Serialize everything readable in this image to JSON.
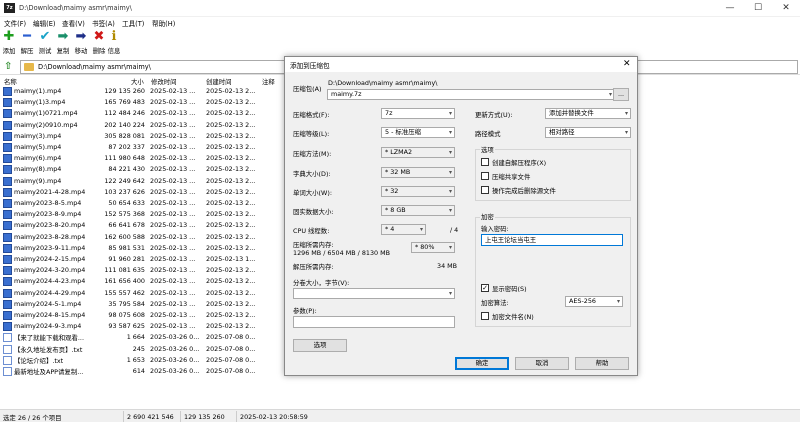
{
  "window": {
    "title": "D:\\Download\\maimy asmr\\maimy\\",
    "app_icon_text": "7z"
  },
  "window_controls": {
    "minimize": "—",
    "maximize": "☐",
    "close": "✕"
  },
  "menu": [
    "文件(F)",
    "编辑(E)",
    "查看(V)",
    "书签(A)",
    "工具(T)",
    "帮助(H)"
  ],
  "toolbar": [
    {
      "label": "添加",
      "icon": "plus-icon",
      "glyph": "✚",
      "color": "#1e9e1e"
    },
    {
      "label": "解压",
      "icon": "minus-icon",
      "glyph": "━",
      "color": "#2b5fd0"
    },
    {
      "label": "测试",
      "icon": "check-icon",
      "glyph": "✔",
      "color": "#1aa3c8"
    },
    {
      "label": "复制",
      "icon": "copy-arrow-icon",
      "glyph": "➡",
      "color": "#1a8f6a"
    },
    {
      "label": "移动",
      "icon": "move-arrow-icon",
      "glyph": "➡",
      "color": "#1e2f88"
    },
    {
      "label": "删除",
      "icon": "delete-x-icon",
      "glyph": "✖",
      "color": "#d01818"
    },
    {
      "label": "信息",
      "icon": "info-icon",
      "glyph": "ℹ",
      "color": "#b08a00"
    }
  ],
  "path": "D:\\Download\\maimy asmr\\maimy\\",
  "columns": {
    "name": "名称",
    "size": "大小",
    "modified": "修改时间",
    "created": "创建时间",
    "comment": "注释"
  },
  "files": [
    {
      "name": "maimy(1).mp4",
      "size": "129 135 260",
      "modified": "2025-02-13 ...",
      "created": "2025-02-13 2...",
      "type": "video"
    },
    {
      "name": "maimy(1)3.mp4",
      "size": "165 769 483",
      "modified": "2025-02-13 ...",
      "created": "2025-02-13 2...",
      "type": "video"
    },
    {
      "name": "maimy(1)0721.mp4",
      "size": "112 484 246",
      "modified": "2025-02-13 ...",
      "created": "2025-02-13 2...",
      "type": "video"
    },
    {
      "name": "maimy(2)0910.mp4",
      "size": "202 140 224",
      "modified": "2025-02-13 ...",
      "created": "2025-02-13 2...",
      "type": "video"
    },
    {
      "name": "maimy(3).mp4",
      "size": "305 828 081",
      "modified": "2025-02-13 ...",
      "created": "2025-02-13 2...",
      "type": "video"
    },
    {
      "name": "maimy(5).mp4",
      "size": "87 202 337",
      "modified": "2025-02-13 ...",
      "created": "2025-02-13 2...",
      "type": "video"
    },
    {
      "name": "maimy(6).mp4",
      "size": "111 980 648",
      "modified": "2025-02-13 ...",
      "created": "2025-02-13 2...",
      "type": "video"
    },
    {
      "name": "maimy(8).mp4",
      "size": "84 221 430",
      "modified": "2025-02-13 ...",
      "created": "2025-02-13 2...",
      "type": "video"
    },
    {
      "name": "maimy(9).mp4",
      "size": "122 249 642",
      "modified": "2025-02-13 ...",
      "created": "2025-02-13 2...",
      "type": "video"
    },
    {
      "name": "maimy2021-4-28.mp4",
      "size": "103 237 626",
      "modified": "2025-02-13 ...",
      "created": "2025-02-13 2...",
      "type": "video"
    },
    {
      "name": "maimy2023-8-5.mp4",
      "size": "50 654 633",
      "modified": "2025-02-13 ...",
      "created": "2025-02-13 2...",
      "type": "video"
    },
    {
      "name": "maimy2023-8-9.mp4",
      "size": "152 575 368",
      "modified": "2025-02-13 ...",
      "created": "2025-02-13 2...",
      "type": "video"
    },
    {
      "name": "maimy2023-8-20.mp4",
      "size": "66 641 678",
      "modified": "2025-02-13 ...",
      "created": "2025-02-13 2...",
      "type": "video"
    },
    {
      "name": "maimy2023-8-28.mp4",
      "size": "162 600 588",
      "modified": "2025-02-13 ...",
      "created": "2025-02-13 2...",
      "type": "video"
    },
    {
      "name": "maimy2023-9-11.mp4",
      "size": "85 981 531",
      "modified": "2025-02-13 ...",
      "created": "2025-02-13 2...",
      "type": "video"
    },
    {
      "name": "maimy2024-2-15.mp4",
      "size": "91 960 281",
      "modified": "2025-02-13 ...",
      "created": "2025-02-13 1...",
      "type": "video"
    },
    {
      "name": "maimy2024-3-20.mp4",
      "size": "111 081 635",
      "modified": "2025-02-13 ...",
      "created": "2025-02-13 2...",
      "type": "video"
    },
    {
      "name": "maimy2024-4-23.mp4",
      "size": "161 656 400",
      "modified": "2025-02-13 ...",
      "created": "2025-02-13 2...",
      "type": "video"
    },
    {
      "name": "maimy2024-4-29.mp4",
      "size": "155 557 462",
      "modified": "2025-02-13 ...",
      "created": "2025-02-13 2...",
      "type": "video"
    },
    {
      "name": "maimy2024-5-1.mp4",
      "size": "35 795 584",
      "modified": "2025-02-13 ...",
      "created": "2025-02-13 2...",
      "type": "video"
    },
    {
      "name": "maimy2024-8-15.mp4",
      "size": "98 075 608",
      "modified": "2025-02-13 ...",
      "created": "2025-02-13 2...",
      "type": "video"
    },
    {
      "name": "maimy2024-9-3.mp4",
      "size": "93 587 625",
      "modified": "2025-02-13 ...",
      "created": "2025-02-13 2...",
      "type": "video"
    },
    {
      "name": "【来了就能下载和观看...",
      "size": "1 664",
      "modified": "2025-03-26 0...",
      "created": "2025-07-08 0...",
      "type": "text"
    },
    {
      "name": "【永久地址发布页】.txt",
      "size": "245",
      "modified": "2025-03-26 0...",
      "created": "2025-07-08 0...",
      "type": "text"
    },
    {
      "name": "【论坛介绍】.txt",
      "size": "1 653",
      "modified": "2025-03-26 0...",
      "created": "2025-07-08 0...",
      "type": "text"
    },
    {
      "name": "最新地址及APP请复制...",
      "size": "614",
      "modified": "2025-03-26 0...",
      "created": "2025-07-08 0...",
      "type": "text"
    }
  ],
  "status": {
    "selection": "选定 26 / 26 个项目",
    "total_size": "2 690 421 546",
    "selected_size": "129 135 260",
    "datetime": "2025-02-13 20:58:59"
  },
  "dialog": {
    "title": "添加到压缩包",
    "close": "✕",
    "archive_label": "压缩包(A)",
    "archive_dir": "D:\\Download\\maimy asmr\\maimy\\",
    "archive_name": "maimy.7z",
    "browse": "...",
    "format_label": "压缩格式(F):",
    "format_value": "7z",
    "level_label": "压缩等级(L):",
    "level_value": "5 - 标准压缩",
    "method_label": "压缩方法(M):",
    "method_value": "* LZMA2",
    "dict_label": "字典大小(D):",
    "dict_value": "* 32 MB",
    "word_label": "单词大小(W):",
    "word_value": "* 32",
    "solid_label": "固实数据大小:",
    "solid_value": "* 8 GB",
    "cpu_label": "CPU 线程数:",
    "cpu_value": "* 4",
    "cpu_total": "/ 4",
    "mem_label": "压缩所需内存:",
    "mem_detail": "1296 MB / 6504 MB / 8130 MB",
    "mem_pct": "* 80%",
    "decomp_label": "解压所需内存:",
    "decomp_value": "34 MB",
    "split_label": "分卷大小，字节(V):",
    "params_label": "参数(P):",
    "options_button": "选项",
    "update_label": "更新方式(U):",
    "update_value": "添加并替换文件",
    "pathmode_label": "路径模式",
    "pathmode_value": "相对路径",
    "options_group": "选项",
    "opt_sfx": "创建自解压程序(X)",
    "opt_shared": "压缩共享文件",
    "opt_delete": "操作完成后删除源文件",
    "enc_group": "加密",
    "pwd_label": "输入密码:",
    "pwd_value": "上屯王论坛当屯王",
    "show_pwd": "显示密码(S)",
    "enc_method_label": "加密算法:",
    "enc_method_value": "AES-256",
    "enc_names": "加密文件名(N)",
    "ok": "确定",
    "cancel": "取消",
    "help": "帮助"
  }
}
